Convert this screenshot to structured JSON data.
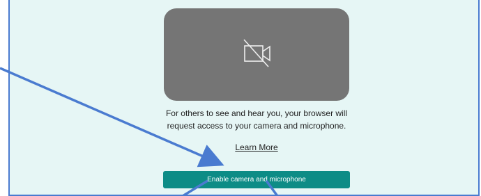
{
  "preview": {
    "icon": "camera-off-icon"
  },
  "prompt": {
    "line1": "For others to see and hear you, your browser will",
    "line2": "request access to your camera and microphone."
  },
  "learn_more_label": "Learn More",
  "enable_button_label": "Enable camera and microphone",
  "colors": {
    "background": "#e6f6f5",
    "preview": "#757575",
    "button": "#0d8c86",
    "annotation_arrow": "#4a7bd0"
  }
}
